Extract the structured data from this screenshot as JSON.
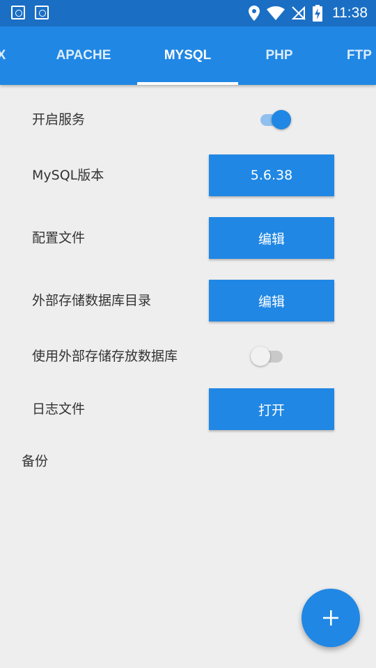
{
  "status_bar": {
    "time": "11:38",
    "left_icons": [
      "notification-app-icon",
      "notification-app-icon"
    ],
    "right_icons": [
      "location-icon",
      "wifi-icon",
      "no-sim-icon",
      "battery-charging-icon"
    ]
  },
  "tabs": [
    {
      "label": "X",
      "active": false
    },
    {
      "label": "APACHE",
      "active": false
    },
    {
      "label": "MYSQL",
      "active": true
    },
    {
      "label": "PHP",
      "active": false
    },
    {
      "label": "FTP",
      "active": false
    }
  ],
  "settings": {
    "start_service": {
      "label": "开启服务",
      "enabled": true
    },
    "mysql_version": {
      "label": "MySQL版本",
      "value": "5.6.38"
    },
    "config_file": {
      "label": "配置文件",
      "button": "编辑"
    },
    "external_db_dir": {
      "label": "外部存储数据库目录",
      "button": "编辑"
    },
    "use_external_storage": {
      "label": "使用外部存储存放数据库",
      "enabled": false
    },
    "log_file": {
      "label": "日志文件",
      "button": "打开"
    }
  },
  "backup": {
    "label": "备份"
  },
  "fab": {
    "icon": "plus-icon"
  },
  "colors": {
    "primary": "#2087e4",
    "status_bar": "#1a6fc4",
    "background": "#eeeeee",
    "text": "#333333"
  }
}
